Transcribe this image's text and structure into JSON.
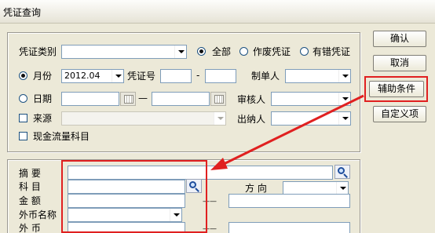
{
  "window": {
    "title": "凭证查询"
  },
  "buttons": {
    "ok": "确认",
    "cancel": "取消",
    "aux": "辅助条件",
    "custom": "自定义项"
  },
  "top": {
    "voucher_type_label": "凭证类别",
    "voucher_type_value": "",
    "radio_all": "全部",
    "radio_void": "作废凭证",
    "radio_error": "有错凭证",
    "month_label": "月份",
    "month_value": "2012.04",
    "voucher_no_label": "凭证号",
    "voucher_no_from": "",
    "voucher_no_sep": "-",
    "voucher_no_to": "",
    "maker_label": "制单人",
    "maker_value": "",
    "date_label": "日期",
    "date_from": "",
    "date_sep": "—",
    "date_to": "",
    "reviewer_label": "审核人",
    "reviewer_value": "",
    "source_label": "来源",
    "source_value": "",
    "cashier_label": "出纳人",
    "cashier_value": "",
    "cashflow_label": "现金流量科目"
  },
  "bottom": {
    "summary_label": "摘  要",
    "summary_value": "",
    "account_label": "科  目",
    "account_value": "",
    "direction_label": "方  向",
    "direction_value": "",
    "amount_label": "金  额",
    "amount_from": "",
    "amount_sep": "——",
    "amount_to": "",
    "currency_label": "外币名称",
    "currency_value": "",
    "fx_label": "外  币",
    "fx_from": "",
    "fx_sep": "——",
    "fx_to": ""
  },
  "colors": {
    "highlight": "#e02020",
    "dialog_bg": "#ece9d8",
    "field_border": "#7f9db9"
  }
}
